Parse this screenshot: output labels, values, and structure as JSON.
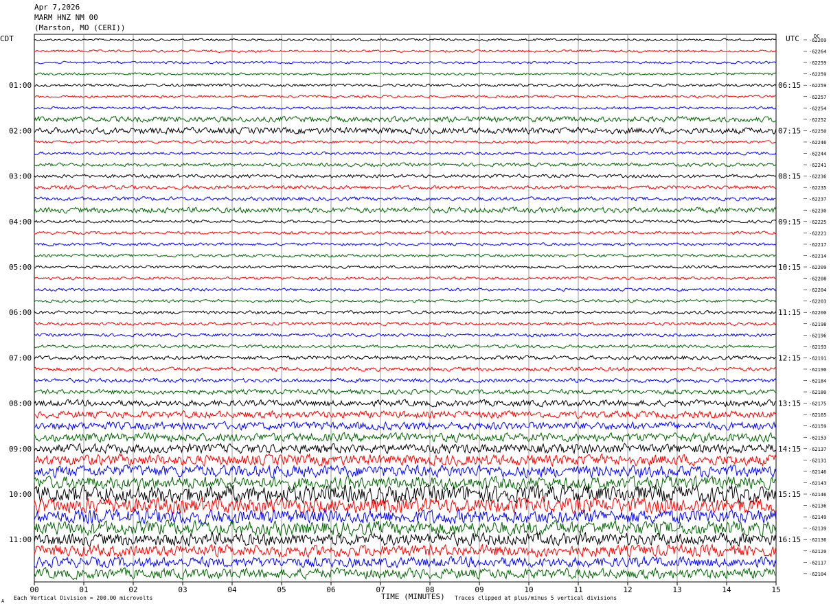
{
  "header": {
    "date": "Apr 7,2026",
    "station": "MARM HNZ NM 00",
    "location": "(Marston, MO (CERI))"
  },
  "left_zone": "CDT",
  "right_zone": "UTC",
  "dc_label": "DC",
  "footer": {
    "scale_note": "Each Vertical Division =  200.00 microvolts",
    "xlabel": "TIME (MINUTES)",
    "clip_note": "Traces clipped at plus/minus 5 vertical divisions",
    "corner_mark": "A"
  },
  "chart_data": {
    "type": "line",
    "title": "",
    "xlabel": "TIME (MINUTES)",
    "ylabel": "",
    "xlim": [
      0,
      15
    ],
    "x_ticks": [
      "00",
      "01",
      "02",
      "03",
      "04",
      "05",
      "06",
      "07",
      "08",
      "09",
      "10",
      "11",
      "12",
      "13",
      "14",
      "15"
    ],
    "grid": true,
    "trace_colors": [
      "#000000",
      "#ff0000",
      "#0000ff",
      "#006400"
    ],
    "rows": 48,
    "left_hour_labels": [
      "01:00",
      "02:00",
      "03:00",
      "04:00",
      "05:00",
      "06:00",
      "07:00",
      "08:00",
      "09:00",
      "10:00",
      "11:00"
    ],
    "right_hour_labels": [
      "06:15",
      "07:15",
      "08:15",
      "09:15",
      "10:15",
      "11:15",
      "12:15",
      "13:15",
      "14:15",
      "15:15",
      "16:15"
    ],
    "hour_label_row_start": 4,
    "hour_label_row_step": 4,
    "dc_offsets": [
      "-62269",
      "-62264",
      "-62259",
      "-62259",
      "-62259",
      "-62257",
      "-62254",
      "-62252",
      "-62250",
      "-62246",
      "-62244",
      "-62241",
      "-62236",
      "-62235",
      "-62237",
      "-62230",
      "-62225",
      "-62221",
      "-62217",
      "-62214",
      "-62209",
      "-62208",
      "-62204",
      "-62203",
      "-62200",
      "-62198",
      "-62196",
      "-62193",
      "-62191",
      "-62190",
      "-62184",
      "-62180",
      "-62175",
      "-62165",
      "-62159",
      "-62153",
      "-62137",
      "-62131",
      "-62146",
      "-62143",
      "-62146",
      "-62136",
      "-62149",
      "-62139",
      "-62136",
      "-62120",
      "-62117",
      "-62104"
    ],
    "trace_noise_amplitude": [
      1.5,
      1.5,
      1.5,
      1.5,
      1.8,
      1.6,
      1.6,
      3.5,
      4,
      1.8,
      1.8,
      2.2,
      2.2,
      2.4,
      2.4,
      3.5,
      1.8,
      1.8,
      1.8,
      1.8,
      1.8,
      1.8,
      1.8,
      1.8,
      2,
      2,
      2,
      2,
      2.5,
      2.5,
      2.5,
      3,
      4,
      4.5,
      5,
      5.5,
      6,
      7,
      7.5,
      8,
      11,
      10,
      9,
      9,
      8,
      7.5,
      6.5,
      6.5
    ]
  }
}
